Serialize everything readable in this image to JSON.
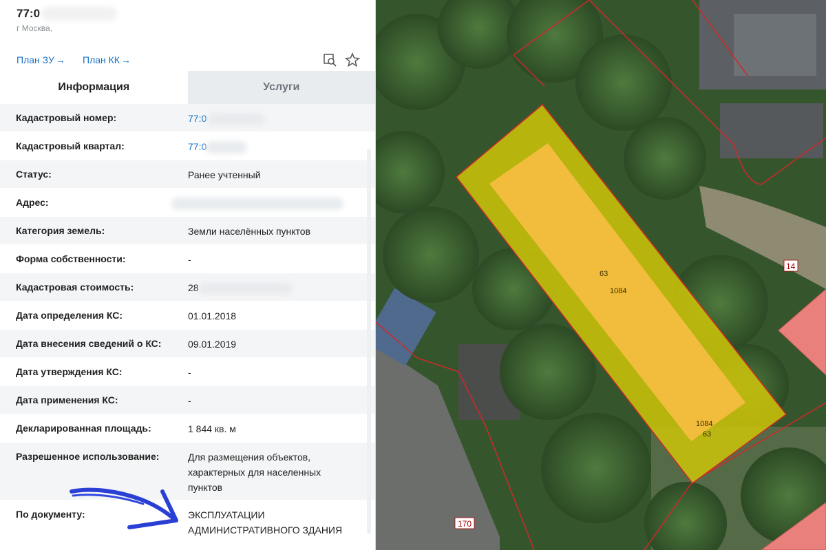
{
  "header": {
    "cadastral_title": "77:0",
    "city": "г Москва,",
    "plan_zu": "План ЗУ",
    "plan_kk": "План КК",
    "arrow": "→",
    "icons": [
      "search-map-icon",
      "star-icon"
    ]
  },
  "tabs": [
    {
      "label": "Информация",
      "active": true
    },
    {
      "label": "Услуги",
      "active": false
    }
  ],
  "rows": [
    {
      "label": "Кадастровый номер:",
      "value": "77:0",
      "link": true,
      "blurred": true
    },
    {
      "label": "Кадастровый квартал:",
      "value": "77:0",
      "link": true,
      "blurred": true
    },
    {
      "label": "Статус:",
      "value": "Ранее учтенный"
    },
    {
      "label": "Адрес:",
      "value": "",
      "blurred": true
    },
    {
      "label": "Категория земель:",
      "value": "Земли населённых пунктов"
    },
    {
      "label": "Форма собственности:",
      "value": "-"
    },
    {
      "label": "Кадастровая стоимость:",
      "value": "28",
      "blurred": true
    },
    {
      "label": "Дата определения КС:",
      "value": "01.01.2018"
    },
    {
      "label": "Дата внесения сведений о КС:",
      "value": "09.01.2019"
    },
    {
      "label": "Дата утверждения КС:",
      "value": "-"
    },
    {
      "label": "Дата применения КС:",
      "value": "-"
    },
    {
      "label": "Декларированная площадь:",
      "value": "1 844 кв. м"
    },
    {
      "label": "Разрешенное использование:",
      "value": "Для размещения объектов, характерных для населенных пунктов"
    },
    {
      "label": "По документу:",
      "value": "ЭКСПЛУАТАЦИИ АДМИНИСТРАТИВНОГО ЗДАНИЯ"
    }
  ],
  "map": {
    "parcel_labels": [
      "63",
      "1084"
    ],
    "corner_labels": [
      "1084",
      "63"
    ],
    "number_badges": [
      "14",
      "170"
    ],
    "colors": {
      "parcel_fill": "#c9c10a",
      "building_fill": "#f2bd3c",
      "boundary": "#d0282a",
      "pink_block": "#e9807c",
      "annotation_arrow": "#2a3fd4"
    }
  }
}
